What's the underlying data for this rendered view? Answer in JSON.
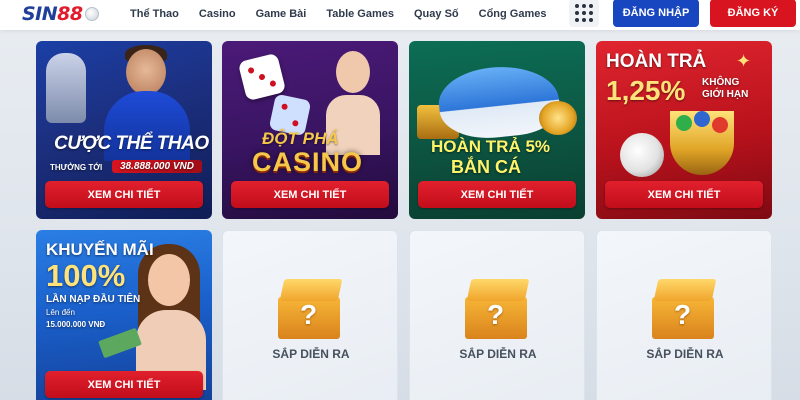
{
  "header": {
    "logo": {
      "text_main": "SIN",
      "text_num": "88",
      "icon": "soccer-ball-icon"
    },
    "nav": [
      "Thể Thao",
      "Casino",
      "Game Bài",
      "Table Games",
      "Quay Số",
      "Cổng Games"
    ],
    "menu_icon": "grid-menu-icon",
    "login_label": "ĐĂNG NHẬP",
    "register_label": "ĐĂNG KÝ"
  },
  "cards": [
    {
      "title": "CƯỢC THỂ THAO",
      "sub_label": "THƯỞNG TỚI",
      "amount": "38.888.000 VND",
      "button": "XEM CHI TIẾT"
    },
    {
      "title_top": "ĐỘT PHÁ",
      "title_main": "CASINO",
      "button": "XEM CHI TIẾT"
    },
    {
      "title_top": "HOÀN TRẢ 5%",
      "title_main": "BẮN CÁ",
      "button": "XEM CHI TIẾT"
    },
    {
      "title_top": "HOÀN TRẢ",
      "percent": "1,25%",
      "line1": "KHÔNG",
      "line2": "GIỚI HẠN",
      "button": "XEM CHI TIẾT"
    },
    {
      "title_top": "KHUYẾN MÃI",
      "percent": "100%",
      "line1": "LẦN NẠP ĐẦU TIÊN",
      "line2": "Lên đến",
      "line3": "15.000.000 VNĐ",
      "button": "XEM CHI TIẾT"
    }
  ],
  "coming_soon": [
    "SẮP DIỄN RA",
    "SẮP DIỄN RA",
    "SẮP DIỄN RA"
  ],
  "colors": {
    "primary_blue": "#1746c0",
    "primary_red": "#d7141f",
    "accent_gold": "#ffe27a"
  }
}
